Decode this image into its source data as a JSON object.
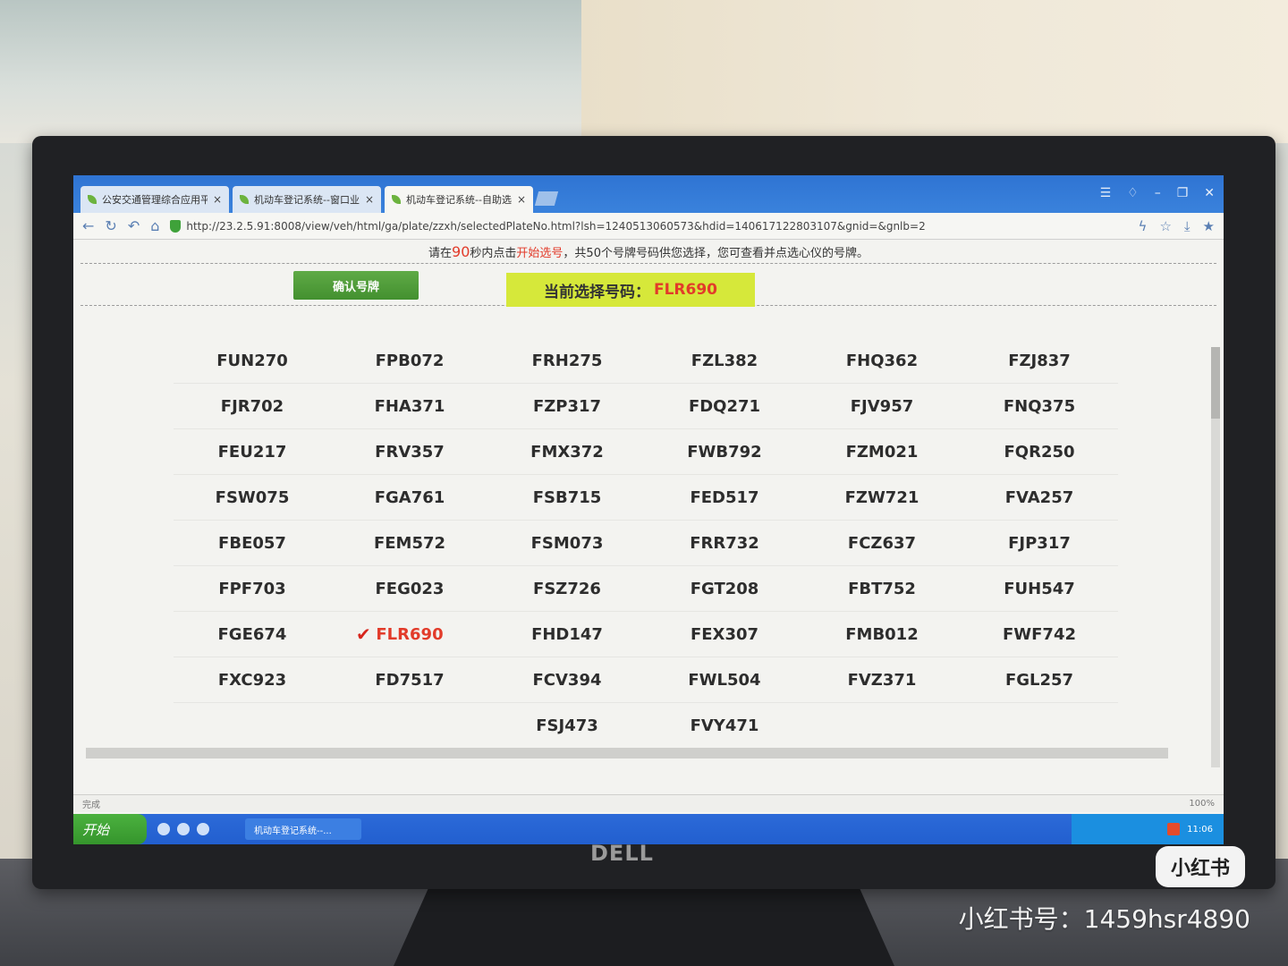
{
  "browser": {
    "tabs": [
      {
        "label": "公安交通管理综合应用平",
        "close": "×"
      },
      {
        "label": "机动车登记系统--窗口业",
        "close": "×"
      },
      {
        "label": "机动车登记系统--自助选",
        "close": "×"
      }
    ],
    "url": "http://23.2.5.91:8008/view/veh/html/ga/plate/zzxh/selectedPlateNo.html?lsh=1240513060573&hdid=140617122803107&gnid=&gnlb=2"
  },
  "notice": {
    "prefix": "请在",
    "seconds": "90",
    "mid": "秒内点击",
    "action": "开始选号",
    "suffix": "，共50个号牌号码供您选择，您可查看并点选心仪的号牌。"
  },
  "toolbar": {
    "confirm_label": "确认号牌",
    "current_label": "当前选择号码：",
    "current_value": "FLR690"
  },
  "plates": {
    "col1": [
      "FUN270",
      "FJR702",
      "FEU217",
      "FSW075",
      "FBE057",
      "FPF703",
      "FGE674",
      "FXC923"
    ],
    "col2": [
      "FPB072",
      "FHA371",
      "FRV357",
      "FGA761",
      "FEM572",
      "FEG023",
      "FLR690",
      "FD7517"
    ],
    "col3": [
      "FRH275",
      "FZP317",
      "FMX372",
      "FSB715",
      "FSM073",
      "FSZ726",
      "FHD147",
      "FCV394",
      "FSJ473"
    ],
    "col4": [
      "FZL382",
      "FDQ271",
      "FWB792",
      "FED517",
      "FRR732",
      "FGT208",
      "FEX307",
      "FWL504",
      "FVY471"
    ],
    "col5": [
      "FHQ362",
      "FJV957",
      "FZM021",
      "FZW721",
      "FCZ637",
      "FBT752",
      "FMB012",
      "FVZ371"
    ],
    "col6": [
      "FZJ837",
      "FNQ375",
      "FQR250",
      "FVA257",
      "FJP317",
      "FUH547",
      "FWF742",
      "FGL257"
    ]
  },
  "statusbar": {
    "left": "完成",
    "zoom": "100%"
  },
  "taskbar": {
    "start": "开始",
    "task": "机动车登记系统--...",
    "clock": "11:06"
  },
  "monitor": {
    "brand": "DELL"
  },
  "overlay": {
    "badge": "小红书",
    "account": "小红书号：1459hsr4890"
  },
  "colors": {
    "accent_red": "#e23b2a",
    "confirm_green": "#4a9a36",
    "highlight_yellow": "#d6e83a"
  }
}
